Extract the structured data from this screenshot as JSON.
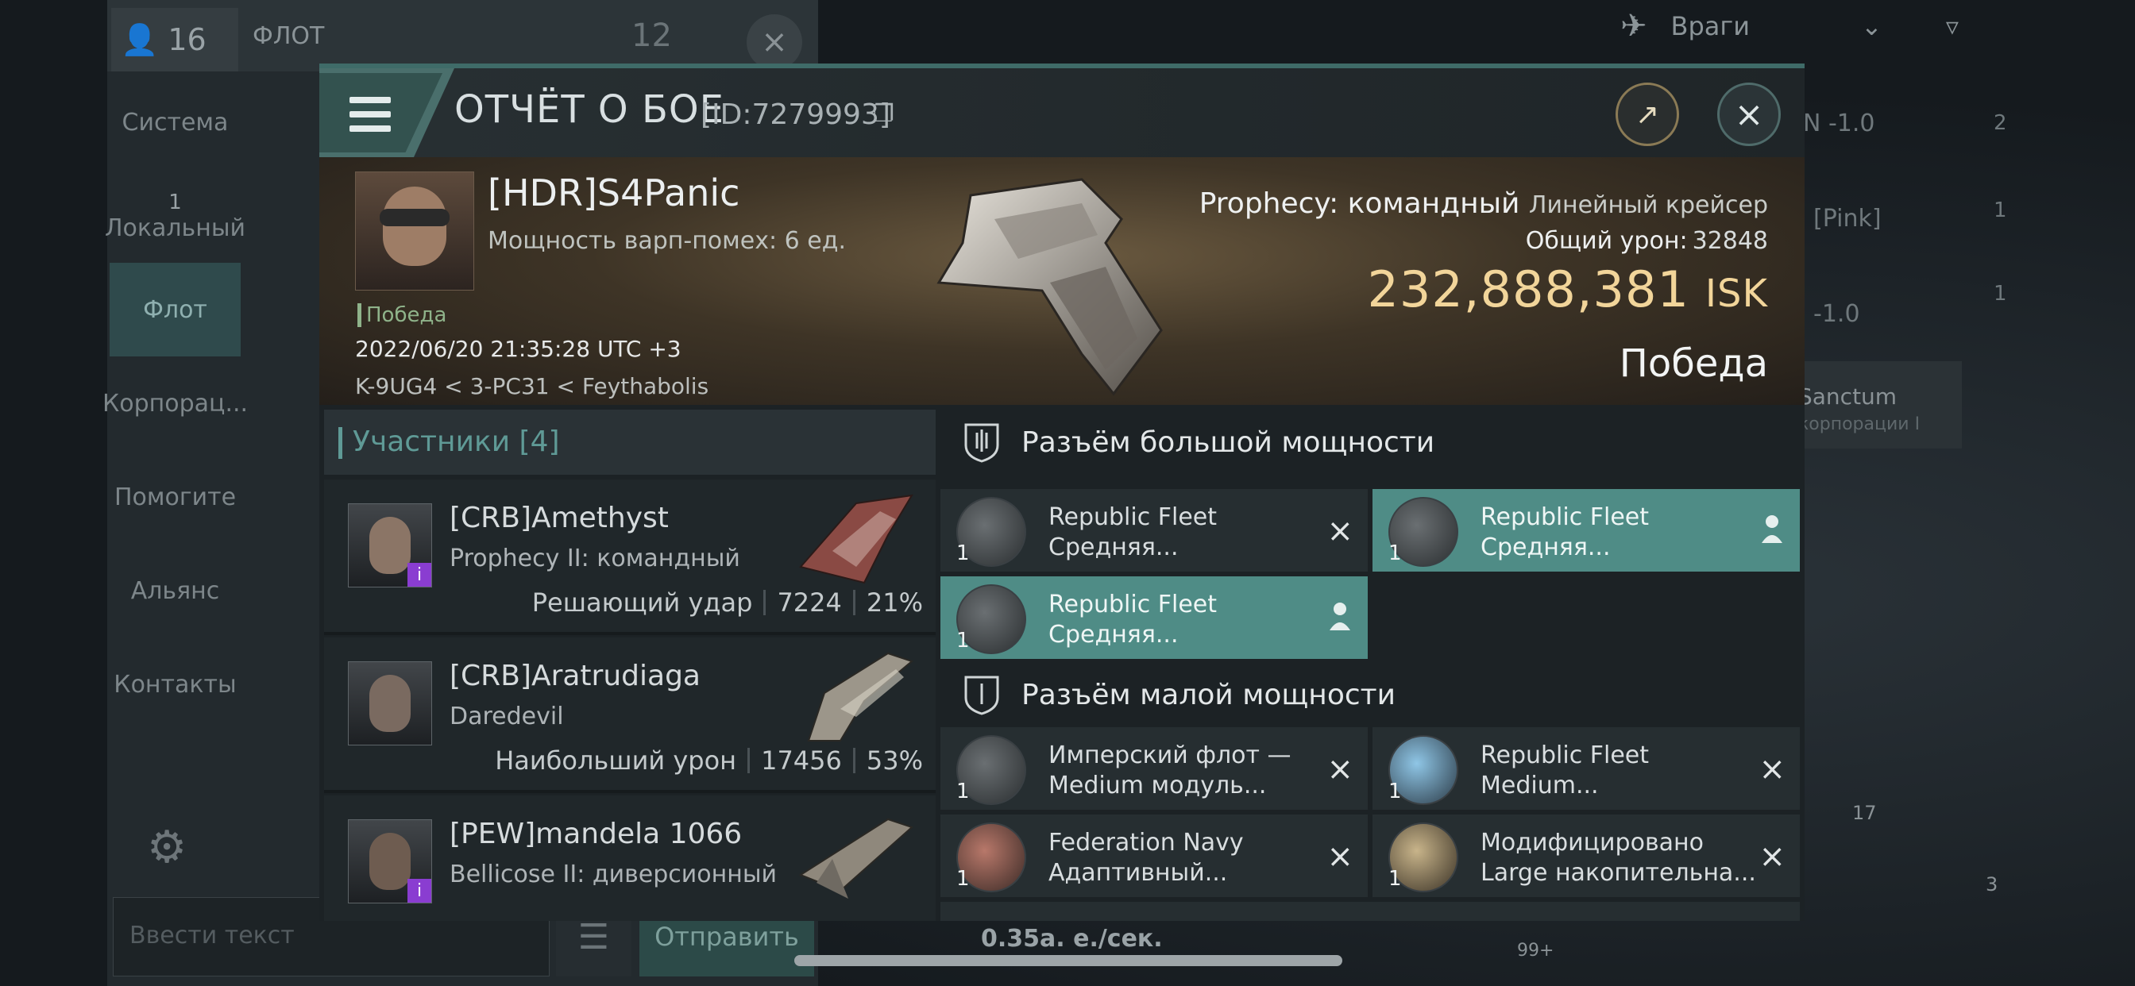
{
  "left_panel": {
    "member_count": "16",
    "title": "ФЛОТ",
    "counter": "12",
    "nav": [
      "Система",
      "Локальный",
      "Флот",
      "Корпорац...",
      "Помогите",
      "Альянс",
      "Контакты"
    ],
    "local_count": "1",
    "input_placeholder": "Ввести текст",
    "send_label": "Отправить",
    "speed": "0.35а. е./сек."
  },
  "right_bg": {
    "filter_label": "Враги",
    "sec1": "N -1.0",
    "pink": "[Pink]",
    "sec2": "-1.0",
    "sanctum": "Sanctum",
    "sanctum_sub": "корпорации I",
    "n2": "2",
    "n1a": "1",
    "n1b": "1",
    "n17": "17",
    "n3": "3",
    "n99": "99+"
  },
  "report": {
    "title": "ОТЧЁТ О БОЕ",
    "id": "[ID:7279993]"
  },
  "victim": {
    "name": "[HDR]S4Panic",
    "warp": "Мощность варп-помех: 6 ед.",
    "tag": "Победа",
    "datetime": "2022/06/20 21:35:28 UTC +3",
    "location": "K-9UG4 < 3-PC31 < Feythabolis",
    "ship": "Prophecy: командный",
    "ship_class": "Линейный крейсер",
    "total_damage_label": "Общий урон:",
    "total_damage": "32848",
    "isk_value": "232,888,381",
    "isk_currency": "ISK",
    "result": "Победа"
  },
  "participants": {
    "label": "Участники [4]",
    "rows": [
      {
        "name": "[CRB]Amethyst",
        "ship": "Prophecy II: командный",
        "role": "Решающий удар",
        "damage": "7224",
        "percent": "21%"
      },
      {
        "name": "[CRB]Aratrudiaga",
        "ship": "Daredevil",
        "role": "Наибольший урон",
        "damage": "17456",
        "percent": "53%"
      },
      {
        "name": "[PEW]mandela 1066",
        "ship": "Bellicose II: диверсионный",
        "role": "",
        "damage": "",
        "percent": ""
      }
    ]
  },
  "slots": {
    "high_label": "Разъём большой мощности",
    "low_label": "Разъём малой мощности",
    "high": [
      {
        "l1": "Republic Fleet",
        "l2": "Средняя...",
        "qty": "1"
      },
      {
        "l1": "Republic Fleet",
        "l2": "Средняя...",
        "qty": "1"
      },
      {
        "l1": "Republic Fleet",
        "l2": "Средняя...",
        "qty": "1"
      }
    ],
    "low": [
      {
        "l1": "Имперский флот —",
        "l2": "Medium модуль...",
        "qty": "1"
      },
      {
        "l1": "Republic Fleet",
        "l2": "Medium...",
        "qty": "1"
      },
      {
        "l1": "Federation Navy",
        "l2": "Адаптивный...",
        "qty": "1"
      },
      {
        "l1": "Модифицировано",
        "l2": "Large накопительна...",
        "qty": "1"
      }
    ]
  },
  "colors": {
    "accent": "#4f8c86",
    "isk": "#f2d59a",
    "victory_tag": "#8fb38a"
  }
}
